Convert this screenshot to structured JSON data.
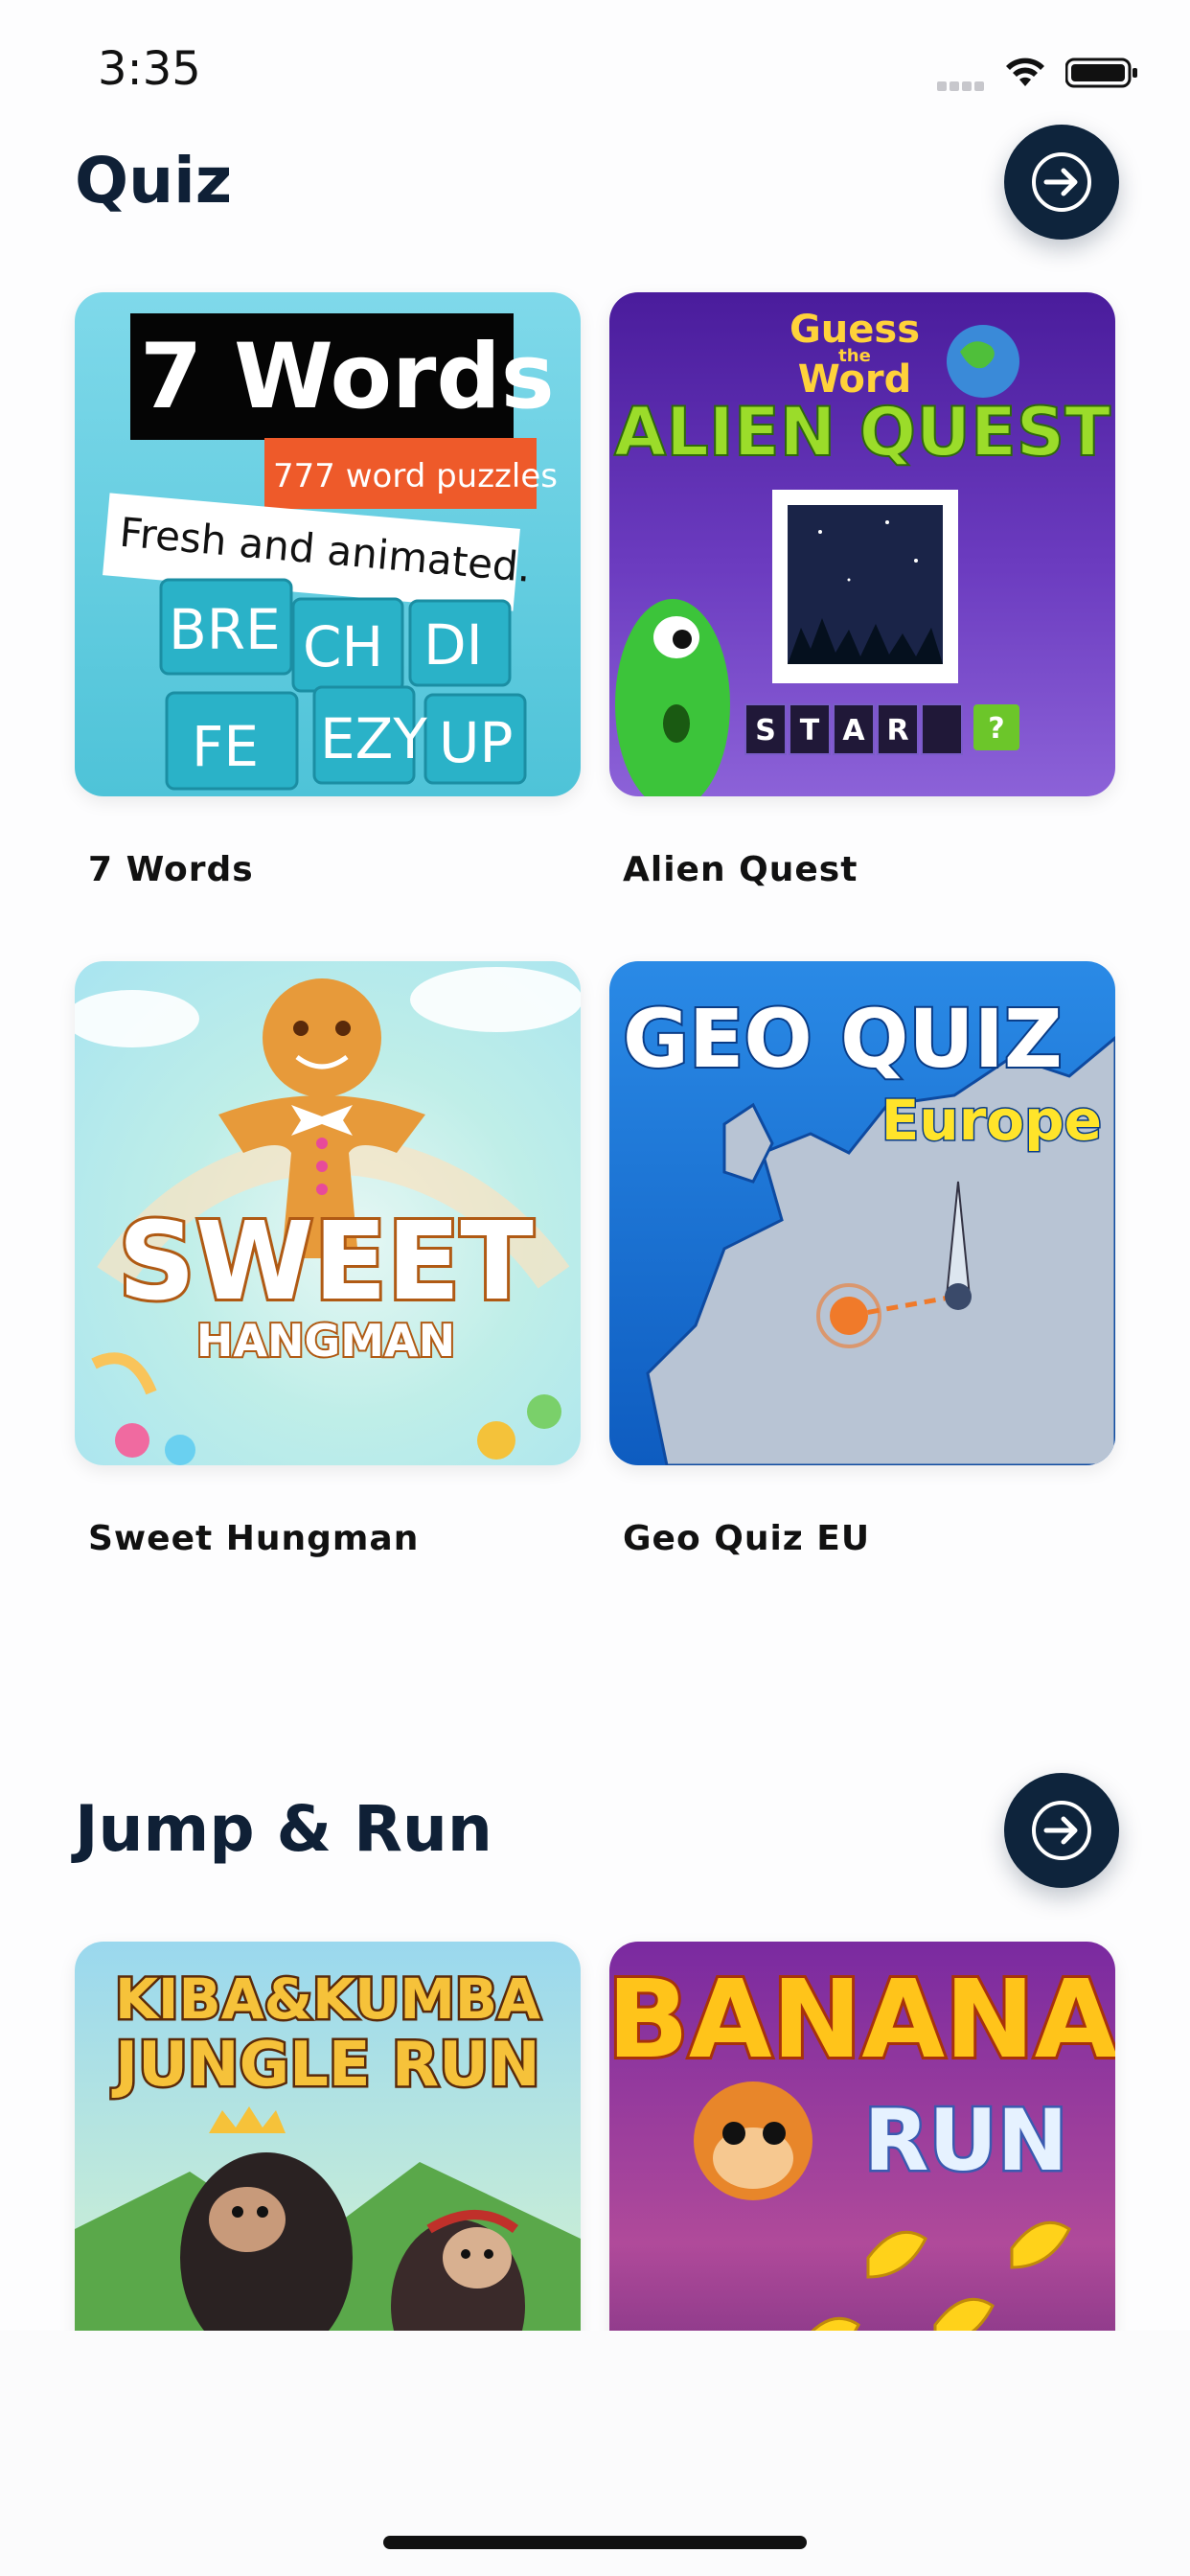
{
  "status": {
    "time": "3:35"
  },
  "sections": [
    {
      "title": "Quiz",
      "games": [
        {
          "label": "7 Words",
          "art": [
            "7 Words",
            "777 word puzzles",
            "Fresh and animated.",
            "BRE",
            "CH",
            "DI",
            "FE",
            "EZY",
            "UP"
          ]
        },
        {
          "label": "Alien Quest",
          "art": [
            "Guess",
            "the",
            "Word",
            "ALIEN QUEST",
            "S",
            "T",
            "A",
            "R",
            "?"
          ]
        },
        {
          "label": "Sweet Hungman",
          "art": [
            "SWEET",
            "HANGMAN"
          ]
        },
        {
          "label": "Geo Quiz EU",
          "art": [
            "GEO QUIZ",
            "Europe"
          ]
        }
      ]
    },
    {
      "title": "Jump & Run",
      "games": [
        {
          "art": [
            "KIBA&KUMBA",
            "JUNGLE RUN"
          ]
        },
        {
          "art": [
            "BANANA",
            "RUN"
          ]
        }
      ]
    }
  ],
  "colors": {
    "navy": "#0e243c",
    "seven_words_bg": "#5fcde0",
    "alien_bg": "#5a2ca8",
    "sweet_bg": "#bfeee8",
    "geo_bg": "#1a78d6",
    "jungle_bg": "#8fd0e8",
    "banana_bg": "#8a2a8f"
  }
}
